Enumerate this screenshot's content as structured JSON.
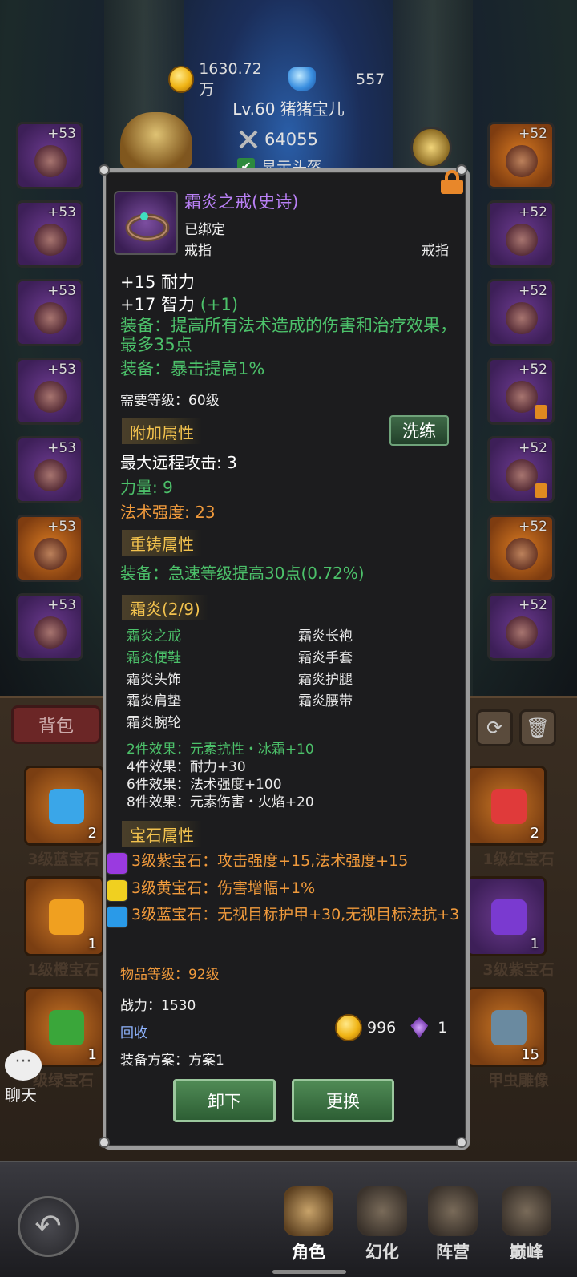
{
  "header": {
    "gold": "1630.72万",
    "gems": "557",
    "player": "Lv.60 猪猪宝儿",
    "power": "64055",
    "show_helmet": "显示头盔"
  },
  "left_slots": [
    {
      "level": "+53",
      "quality": "purple"
    },
    {
      "level": "+53",
      "quality": "purple"
    },
    {
      "level": "+53",
      "quality": "purple"
    },
    {
      "level": "+53",
      "quality": "purple"
    },
    {
      "level": "+53",
      "quality": "purple"
    },
    {
      "level": "+53",
      "quality": "orange"
    },
    {
      "level": "+53",
      "quality": "purple"
    }
  ],
  "right_slots": [
    {
      "level": "+52",
      "quality": "orange"
    },
    {
      "level": "+52",
      "quality": "purple"
    },
    {
      "level": "+52",
      "quality": "purple"
    },
    {
      "level": "+52",
      "quality": "purple",
      "locked": true
    },
    {
      "level": "+52",
      "quality": "purple",
      "locked": true
    },
    {
      "level": "+52",
      "quality": "orange"
    },
    {
      "level": "+52",
      "quality": "purple"
    }
  ],
  "bag": {
    "tab": "背包",
    "refresh_icon": "refresh-icon",
    "trash_icon": "trash-icon",
    "items": [
      {
        "name": "3级蓝宝石",
        "count": "2",
        "gem_color": "#3aa6e8"
      },
      {
        "name": "1级红宝石",
        "count": "2",
        "gem_color": "#e03a3a"
      },
      {
        "name": "1级橙宝石",
        "count": "1",
        "gem_color": "#f0a020"
      },
      {
        "name": "3级紫宝石",
        "count": "1",
        "gem_color": "#7a3ad0"
      },
      {
        "name": "级绿宝石",
        "count": "1",
        "gem_color": "#3aa63a"
      },
      {
        "name": "甲虫雕像",
        "count": "15",
        "gem_color": "#6a8aa0"
      }
    ]
  },
  "chat": {
    "bubble": "···",
    "label": "聊天"
  },
  "tooltip": {
    "name": "霜炎之戒(史诗)",
    "bound": "已绑定",
    "type_left": "戒指",
    "type_right": "戒指",
    "stat_stamina": "+15 耐力",
    "stat_int": "+17 智力",
    "stat_int_bonus": "(+1)",
    "equip_1": "装备：提高所有法术造成的伤害和治疗效果，最多35点",
    "equip_2": "装备：暴击提高1%",
    "required_level": "需要等级：60级",
    "extra_title": "附加属性",
    "refine_button": "洗练",
    "extra_1": "最大远程攻击: 3",
    "extra_2": "力量: 9",
    "extra_3": "法术强度: 23",
    "reforge_title": "重铸属性",
    "reforge_1": "装备：急速等级提高30点(0.72%)",
    "set_title": "霜炎(2/9)",
    "set_items_left": [
      "霜炎之戒",
      "霜炎便鞋",
      "霜炎头饰",
      "霜炎肩垫",
      "霜炎腕轮"
    ],
    "set_items_left_owned": [
      true,
      true,
      false,
      false,
      false
    ],
    "set_items_right": [
      "霜炎长袍",
      "霜炎手套",
      "霜炎护腿",
      "霜炎腰带"
    ],
    "set_effects": [
      "2件效果：元素抗性・冰霜+10",
      "4件效果：耐力+30",
      "6件效果：法术强度+100",
      "8件效果：元素伤害・火焰+20"
    ],
    "set_effects_active": [
      true,
      false,
      false,
      false
    ],
    "gem_title": "宝石属性",
    "gems": [
      {
        "text": "3级紫宝石：攻击强度+15,法术强度+15",
        "color": "#9a3ae0"
      },
      {
        "text": "3级黄宝石：伤害增幅+1%",
        "color": "#f0d020"
      },
      {
        "text": "3级蓝宝石：无视目标护甲+30,无视目标法抗+3",
        "color": "#2a9ae8"
      }
    ],
    "item_level": "物品等级：92级",
    "combat_power": "战力：1530",
    "recycle": "回收",
    "sell_gold": "996",
    "sell_gem": "1",
    "scheme": "装备方案：方案1",
    "unequip_button": "卸下",
    "replace_button": "更换"
  },
  "nav": {
    "tabs": [
      {
        "label": "角色",
        "active": true
      },
      {
        "label": "幻化",
        "active": false
      },
      {
        "label": "阵营",
        "active": false
      },
      {
        "label": "巅峰",
        "active": false
      }
    ],
    "back_icon": "back-arrow-icon"
  },
  "colors": {
    "epic": "#b980f5",
    "green": "#4cc16a",
    "orange": "#f09a3c",
    "section": "#f2c24e"
  }
}
